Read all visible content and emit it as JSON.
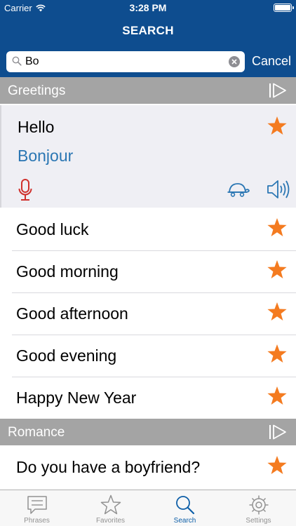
{
  "status_bar": {
    "carrier": "Carrier",
    "time": "3:28 PM"
  },
  "nav": {
    "title": "SEARCH"
  },
  "search": {
    "value": "Bo",
    "cancel_label": "Cancel"
  },
  "sections": [
    {
      "title": "Greetings",
      "expanded_item": {
        "phrase": "Hello",
        "translation": "Bonjour",
        "favorite": true
      },
      "items": [
        {
          "phrase": "Good luck",
          "favorite": true
        },
        {
          "phrase": "Good morning",
          "favorite": true
        },
        {
          "phrase": "Good afternoon",
          "favorite": true
        },
        {
          "phrase": "Good evening",
          "favorite": true
        },
        {
          "phrase": "Happy New Year",
          "favorite": true
        }
      ]
    },
    {
      "title": "Romance",
      "items": [
        {
          "phrase": "Do you have a boyfriend?",
          "favorite": true
        }
      ]
    }
  ],
  "tabs": [
    {
      "label": "Phrases",
      "icon": "chat-bubble-icon",
      "active": false
    },
    {
      "label": "Favorites",
      "icon": "star-outline-icon",
      "active": false
    },
    {
      "label": "Search",
      "icon": "search-icon",
      "active": true
    },
    {
      "label": "Settings",
      "icon": "gear-icon",
      "active": false
    }
  ],
  "colors": {
    "nav_bar": "#0e4d8f",
    "section_header": "#a4a4a4",
    "star": "#f47b20",
    "translation": "#2a76b3",
    "mic": "#d0312d",
    "active_tab": "#0e5fa8"
  }
}
